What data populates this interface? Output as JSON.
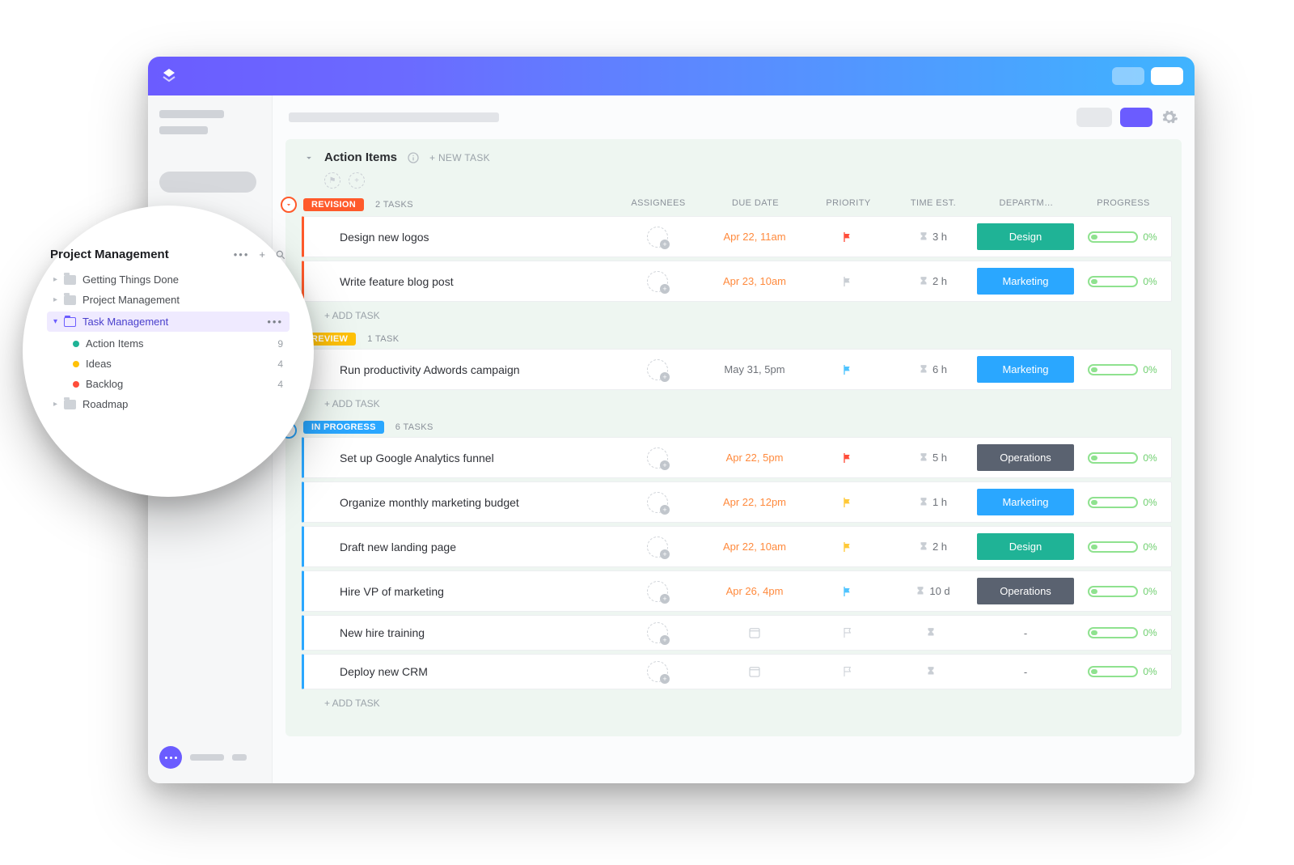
{
  "colors": {
    "accentPurple": "#6b5cff",
    "revision": "#ff5a2b",
    "review": "#ffc107",
    "inProgress": "#2aa7ff",
    "deptDesign": "#1fb396",
    "deptMarketing": "#2aa7ff",
    "deptOperations": "#5a6270",
    "flagRed": "#ff4d3a",
    "flagGrey": "#c9ced4",
    "flagBlue": "#4fc4ff",
    "flagYellow": "#ffc938",
    "dueOrange": "#ff8a3d",
    "dueGrey": "#6e7279"
  },
  "list": {
    "title": "Action Items",
    "newTask": "+ NEW TASK",
    "addTask": "+ ADD TASK",
    "columns": {
      "assignees": "ASSIGNEES",
      "dueDate": "DUE DATE",
      "priority": "PRIORITY",
      "timeEst": "TIME EST.",
      "department": "DEPARTM…",
      "progress": "PROGRESS"
    }
  },
  "groups": [
    {
      "name": "REVISION",
      "countLabel": "2 TASKS",
      "colorKey": "revision",
      "tasks": [
        {
          "title": "Design new logos",
          "due": "Apr 22, 11am",
          "dueColor": "dueOrange",
          "flag": "flagRed",
          "time": "3 h",
          "deptLabel": "Design",
          "deptColor": "deptDesign",
          "progress": "0%"
        },
        {
          "title": "Write feature blog post",
          "due": "Apr 23, 10am",
          "dueColor": "dueOrange",
          "flag": "flagGrey",
          "time": "2 h",
          "deptLabel": "Marketing",
          "deptColor": "deptMarketing",
          "progress": "0%"
        }
      ]
    },
    {
      "name": "REVIEW",
      "countLabel": "1 TASK",
      "colorKey": "review",
      "tasks": [
        {
          "title": "Run productivity Adwords campaign",
          "due": "May 31, 5pm",
          "dueColor": "dueGrey",
          "flag": "flagBlue",
          "time": "6 h",
          "deptLabel": "Marketing",
          "deptColor": "deptMarketing",
          "progress": "0%"
        }
      ]
    },
    {
      "name": "IN PROGRESS",
      "countLabel": "6 TASKS",
      "colorKey": "inProgress",
      "tasks": [
        {
          "title": "Set up Google Analytics funnel",
          "due": "Apr 22, 5pm",
          "dueColor": "dueOrange",
          "flag": "flagRed",
          "time": "5 h",
          "deptLabel": "Operations",
          "deptColor": "deptOperations",
          "progress": "0%"
        },
        {
          "title": "Organize monthly marketing budget",
          "due": "Apr 22, 12pm",
          "dueColor": "dueOrange",
          "flag": "flagYellow",
          "time": "1 h",
          "deptLabel": "Marketing",
          "deptColor": "deptMarketing",
          "progress": "0%"
        },
        {
          "title": "Draft new landing page",
          "due": "Apr 22, 10am",
          "dueColor": "dueOrange",
          "flag": "flagYellow",
          "time": "2 h",
          "deptLabel": "Design",
          "deptColor": "deptDesign",
          "progress": "0%"
        },
        {
          "title": "Hire VP of marketing",
          "due": "Apr 26, 4pm",
          "dueColor": "dueOrange",
          "flag": "flagBlue",
          "time": "10 d",
          "deptLabel": "Operations",
          "deptColor": "deptOperations",
          "progress": "0%"
        },
        {
          "title": "New hire training",
          "due": null,
          "dueColor": null,
          "flag": null,
          "time": null,
          "deptLabel": "-",
          "deptColor": null,
          "progress": "0%"
        },
        {
          "title": "Deploy new CRM",
          "due": null,
          "dueColor": null,
          "flag": null,
          "time": null,
          "deptLabel": "-",
          "deptColor": null,
          "progress": "0%"
        }
      ]
    }
  ],
  "sidebar": {
    "spaceTitle": "Project Management",
    "items": [
      {
        "kind": "folder",
        "label": "Getting Things Done"
      },
      {
        "kind": "folder",
        "label": "Project Management"
      },
      {
        "kind": "folder-active",
        "label": "Task Management"
      },
      {
        "kind": "list",
        "dot": "#1fb396",
        "label": "Action Items",
        "count": "9"
      },
      {
        "kind": "list",
        "dot": "#ffc107",
        "label": "Ideas",
        "count": "4"
      },
      {
        "kind": "list",
        "dot": "#ff4d3a",
        "label": "Backlog",
        "count": "4"
      },
      {
        "kind": "folder",
        "label": "Roadmap"
      }
    ]
  }
}
